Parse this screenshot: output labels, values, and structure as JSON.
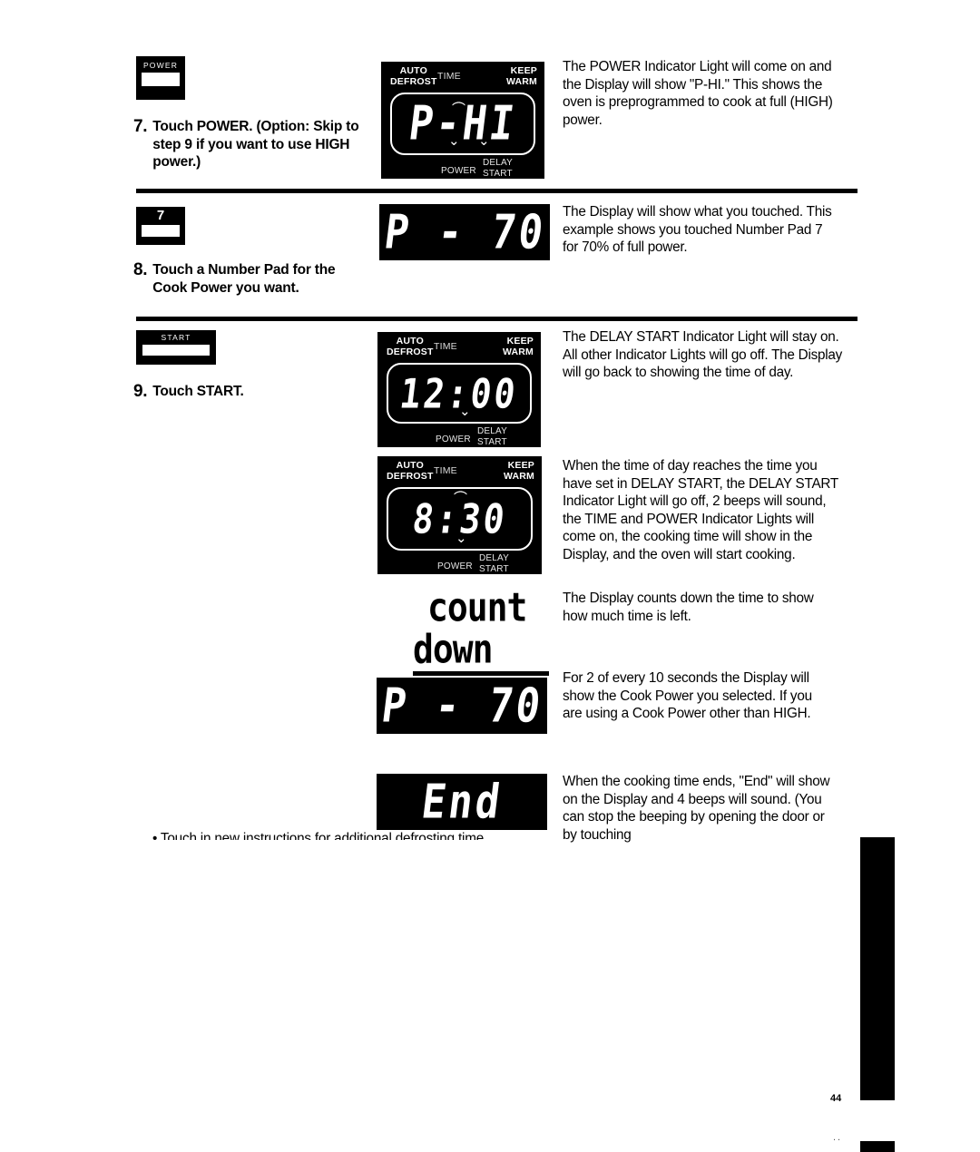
{
  "page": {
    "number": "44",
    "ghost_line": "• Touch in new instructions for additional defrosting time."
  },
  "steps": [
    {
      "number": "7.",
      "instruction": "Touch POWER. (Option: Skip to step 9 if you want to use HIGH power.)",
      "keypad": {
        "label": "POWER",
        "number": ""
      },
      "display": {
        "digits": "P-HI",
        "indicators": {
          "auto_defrost": "AUTO\nDEFROST",
          "time": "TIME",
          "keep_warm": "KEEP\nWARM",
          "power": "POWER",
          "delay_start": "DELAY\nSTART"
        }
      },
      "body": "The POWER Indicator Light will come on and the Display will show \"P-HI.\" This shows the oven is preprogrammed to cook at full (HIGH) power."
    },
    {
      "number": "8.",
      "instruction": "Touch a Number Pad for the Cook Power you want.",
      "keypad": {
        "label": "",
        "number": "7"
      },
      "display": {
        "digits": "P - 70",
        "indicators": {}
      },
      "body": "The Display will show what you touched. This example shows you touched Number Pad 7 for 70% of full power."
    },
    {
      "number": "9.",
      "instruction": "Touch START.",
      "keypad": {
        "label": "START",
        "number": ""
      },
      "display": {
        "digits": "12:00",
        "indicators": {
          "auto_defrost": "AUTO\nDEFROST",
          "time": "TIME",
          "keep_warm": "KEEP\nWARM",
          "power": "POWER",
          "delay_start": "DELAY\nSTART"
        }
      },
      "body": "The DELAY START Indicator Light will stay on. All other Indicator Lights will go off. The Display will go back to showing the time of day."
    }
  ],
  "results": [
    {
      "display": {
        "digits": "8:30",
        "indicators": {
          "auto_defrost": "AUTO\nDEFROST",
          "time": "TIME",
          "keep_warm": "KEEP\nWARM",
          "power": "POWER",
          "delay_start": "DELAY\nSTART"
        }
      },
      "body": "When the time of day reaches the time you have set in DELAY START, the DELAY START Indicator Light will go off, 2 beeps will sound, the TIME and POWER Indicator Lights will come on, the cooking time will show in the Display, and the oven will start cooking."
    },
    {
      "wordmark": {
        "line1": "count",
        "line2": "down"
      },
      "body": "The Display counts down the time to show how much time is left."
    },
    {
      "display": {
        "digits": "P - 70",
        "indicators": {}
      },
      "body": "For 2 of every 10 seconds the Display will show the Cook Power you selected. If you are using a Cook Power other than HIGH."
    },
    {
      "display": {
        "digits": "End",
        "indicators": {}
      },
      "body": "When the cooking time ends, \"End\" will show on the Display and 4 beeps will sound. (You can stop the beeping by opening the door or by touching"
    }
  ]
}
